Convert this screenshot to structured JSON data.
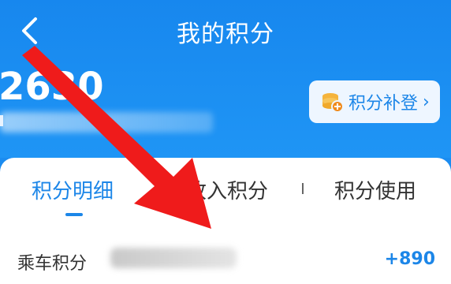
{
  "header": {
    "title": "我的积分",
    "back_icon": "chevron-left-icon",
    "points_value": "2630"
  },
  "makeup_button": {
    "label": "积分补登",
    "icon": "coin-stack-icon",
    "chevron": "›"
  },
  "tabs": [
    {
      "label": "积分明细",
      "active": true
    },
    {
      "label": "收入积分",
      "active": false
    },
    {
      "label": "积分使用",
      "active": false
    }
  ],
  "records": [
    {
      "label": "乘车积分",
      "value": "+890"
    }
  ],
  "colors": {
    "brand_blue": "#1c86e8",
    "header_blue": "#1b8cf0",
    "annotation_red": "#ef1b1b"
  }
}
